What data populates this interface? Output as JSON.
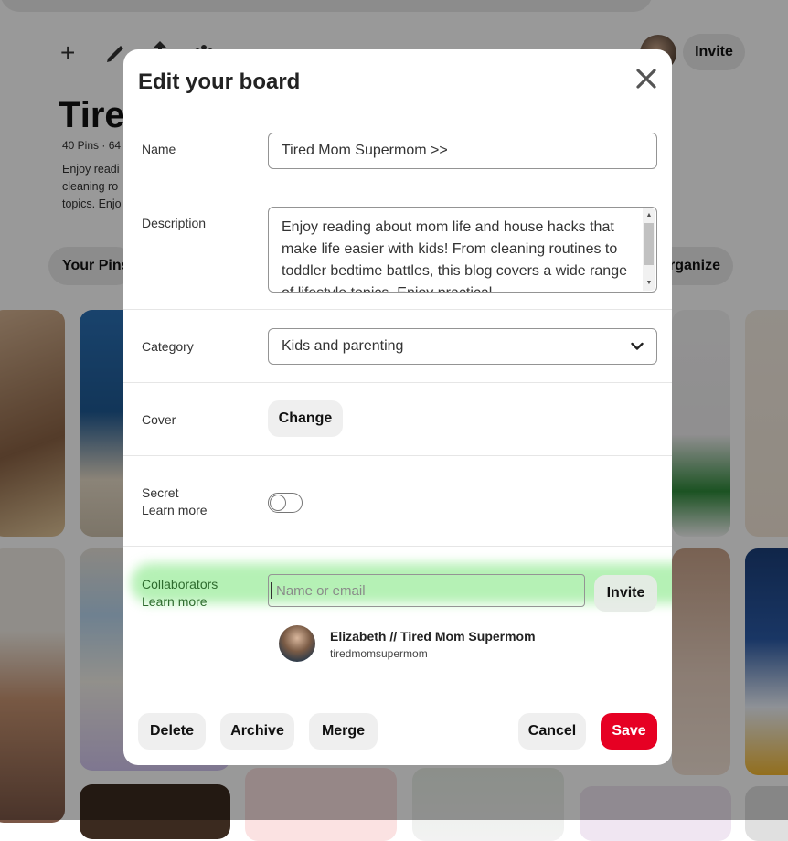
{
  "background": {
    "invite_label": "Invite",
    "board_title": "Tired",
    "board_meta": "40 Pins · 64",
    "board_desc": "Enjoy readi\ncleaning ro\ntopics. Enjo",
    "your_pins_tab": "Your Pins",
    "organize_tab": "rganize",
    "tool_icons": [
      "plus-icon",
      "pencil-icon",
      "share-icon",
      "more-icon"
    ]
  },
  "modal": {
    "title": "Edit your board",
    "name": {
      "label": "Name",
      "value": "Tired Mom Supermom >>"
    },
    "description": {
      "label": "Description",
      "value": "Enjoy reading about mom life and house hacks that make life easier with kids! From cleaning routines to toddler bedtime battles, this blog covers a wide range of lifestyle topics. Enjoy practical"
    },
    "category": {
      "label": "Category",
      "value": "Kids and parenting"
    },
    "cover": {
      "label": "Cover",
      "button": "Change"
    },
    "secret": {
      "label": "Secret",
      "learn_more": "Learn more",
      "enabled": false
    },
    "collaborators": {
      "label": "Collaborators",
      "learn_more": "Learn more",
      "placeholder": "Name or email",
      "invite_button": "Invite",
      "members": [
        {
          "name": "Elizabeth // Tired Mom Supermom",
          "handle": "tiredmomsupermom"
        }
      ]
    },
    "footer": {
      "delete": "Delete",
      "archive": "Archive",
      "merge": "Merge",
      "cancel": "Cancel",
      "save": "Save"
    }
  },
  "colors": {
    "save_red": "#e60023",
    "button_gray": "#efefef",
    "overlay": "rgba(0,0,0,0.40)",
    "highlight_green": "#78e678"
  }
}
